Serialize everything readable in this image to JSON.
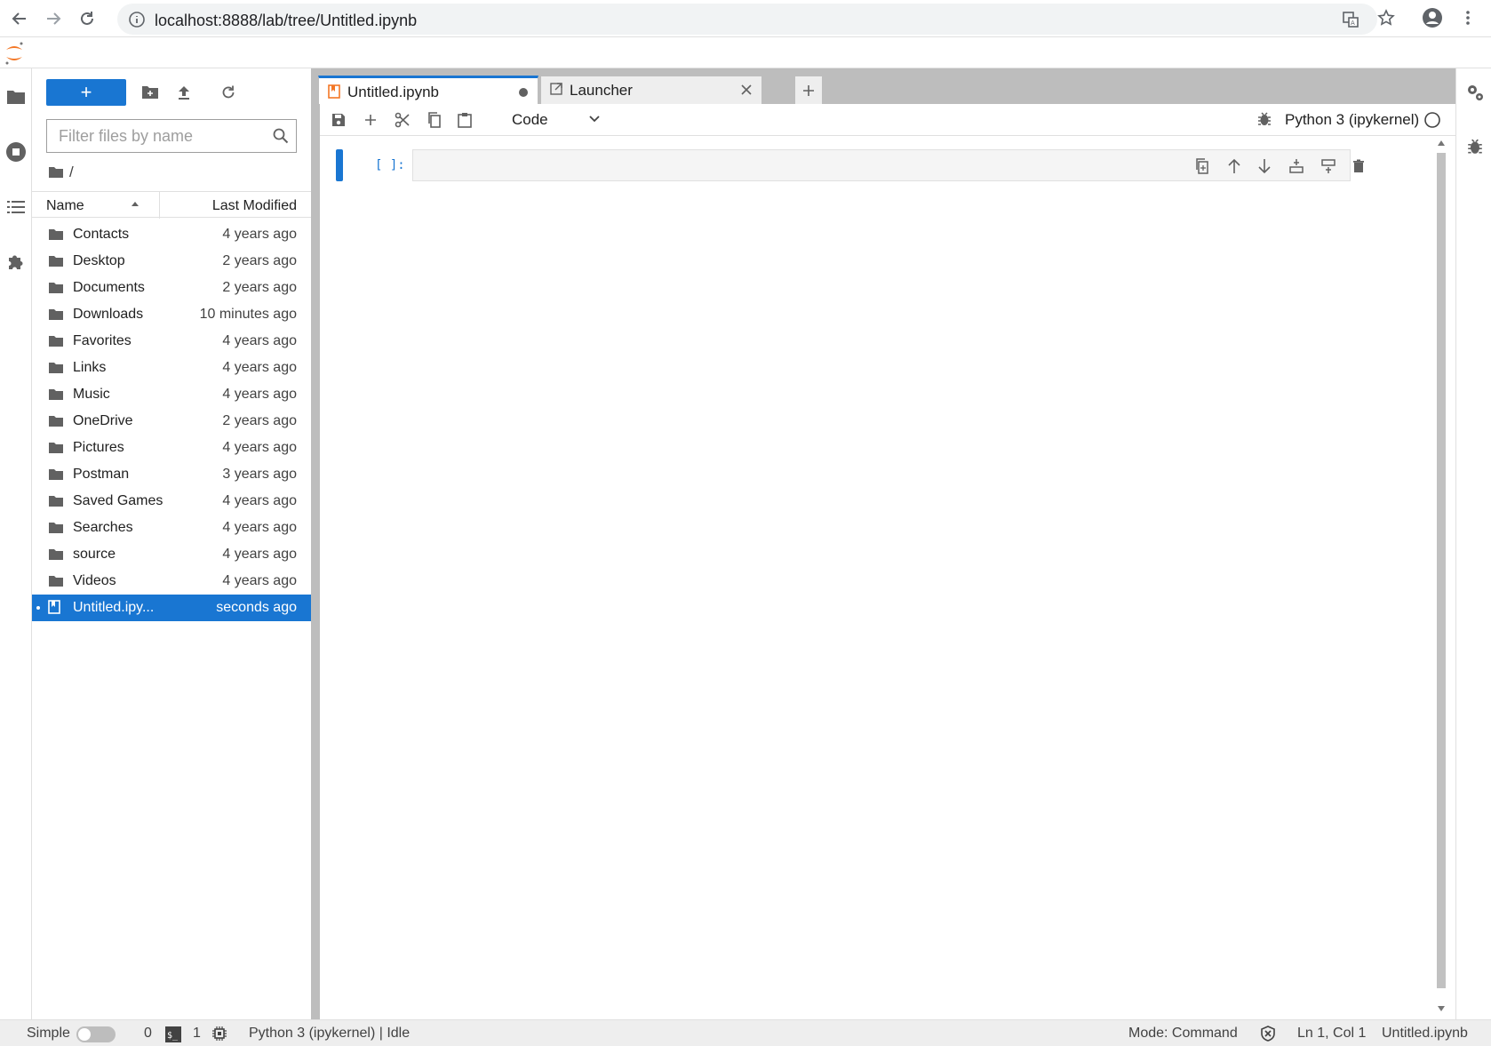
{
  "browser": {
    "url": "localhost:8888/lab/tree/Untitled.ipynb"
  },
  "filebrowser": {
    "new_button_label": "+",
    "filter_placeholder": "Filter files by name",
    "breadcrumb": "/",
    "columns": {
      "name": "Name",
      "modified": "Last Modified"
    },
    "files": [
      {
        "name": "Contacts",
        "modified": "4 years ago",
        "type": "folder"
      },
      {
        "name": "Desktop",
        "modified": "2 years ago",
        "type": "folder"
      },
      {
        "name": "Documents",
        "modified": "2 years ago",
        "type": "folder"
      },
      {
        "name": "Downloads",
        "modified": "10 minutes ago",
        "type": "folder"
      },
      {
        "name": "Favorites",
        "modified": "4 years ago",
        "type": "folder"
      },
      {
        "name": "Links",
        "modified": "4 years ago",
        "type": "folder"
      },
      {
        "name": "Music",
        "modified": "4 years ago",
        "type": "folder"
      },
      {
        "name": "OneDrive",
        "modified": "2 years ago",
        "type": "folder"
      },
      {
        "name": "Pictures",
        "modified": "4 years ago",
        "type": "folder"
      },
      {
        "name": "Postman",
        "modified": "3 years ago",
        "type": "folder"
      },
      {
        "name": "Saved Games",
        "modified": "4 years ago",
        "type": "folder"
      },
      {
        "name": "Searches",
        "modified": "4 years ago",
        "type": "folder"
      },
      {
        "name": "source",
        "modified": "4 years ago",
        "type": "folder"
      },
      {
        "name": "Videos",
        "modified": "4 years ago",
        "type": "folder"
      },
      {
        "name": "Untitled.ipy...",
        "modified": "seconds ago",
        "type": "notebook",
        "selected": true
      }
    ]
  },
  "tabs": [
    {
      "label": "Untitled.ipynb",
      "icon": "notebook-icon",
      "active": true,
      "modified": true
    },
    {
      "label": "Launcher",
      "icon": "launcher-icon",
      "active": false
    }
  ],
  "notebook": {
    "cell_type": "Code",
    "kernel_name": "Python 3 (ipykernel)",
    "cell_prompt": "[ ]:"
  },
  "statusbar": {
    "simple_label": "Simple",
    "terminals_count": "0",
    "kernels_count": "1",
    "kernel_status": "Python 3 (ipykernel) | Idle",
    "mode": "Mode: Command",
    "position": "Ln 1, Col 1",
    "filename": "Untitled.ipynb"
  },
  "colors": {
    "accent": "#1976d2",
    "jupyter_orange": "#f37726"
  }
}
